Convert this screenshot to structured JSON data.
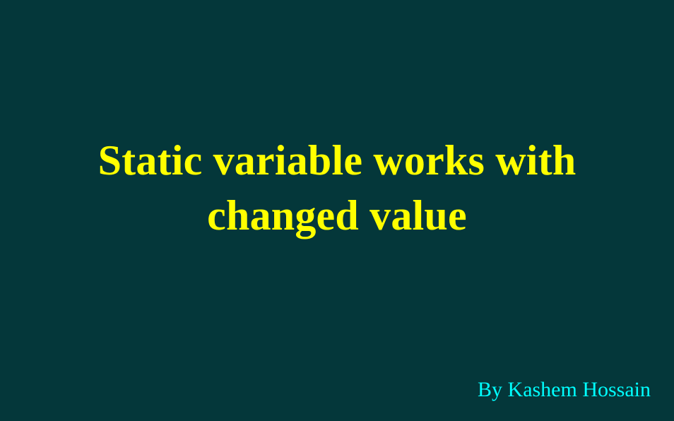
{
  "slide": {
    "title_lines": [
      "Static variable works with",
      "changed value"
    ],
    "author": "By Kashem Hossain"
  },
  "colors": {
    "background": "#04373a",
    "title": "#ffff00",
    "author": "#00ffff"
  }
}
